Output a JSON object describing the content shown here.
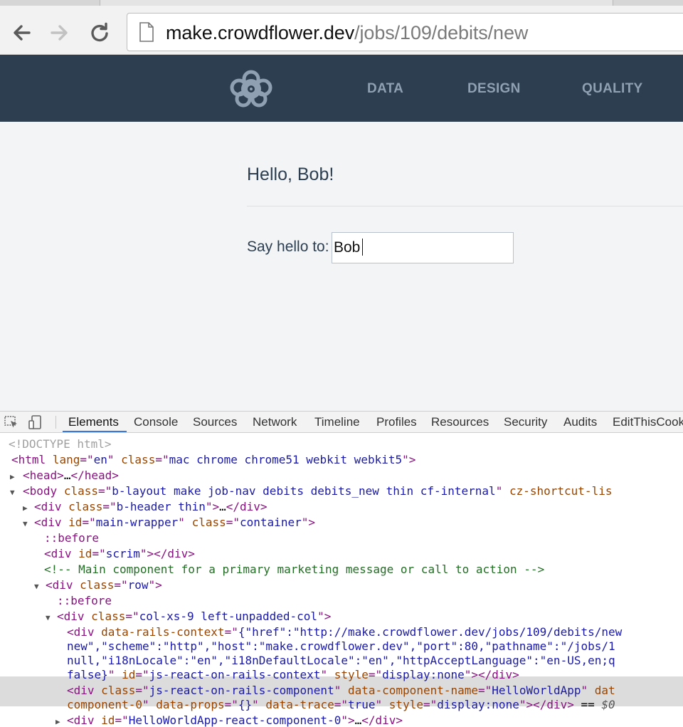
{
  "browser": {
    "url_host": "make.crowdflower.dev",
    "url_path": "/jobs/109/debits/new"
  },
  "site_nav": {
    "items": [
      "DATA",
      "DESIGN",
      "QUALITY"
    ]
  },
  "main": {
    "greeting": "Hello, Bob!",
    "input_label": "Say hello to:",
    "input_value": "Bob"
  },
  "devtools": {
    "tabs": [
      "Elements",
      "Console",
      "Sources",
      "Network",
      "Timeline",
      "Profiles",
      "Resources",
      "Security",
      "Audits",
      "EditThisCook"
    ],
    "active_tab": "Elements",
    "dom": {
      "l1": "<!DOCTYPE html>",
      "l2_tag": "html",
      "l2_lang": "en",
      "l2_class": "mac chrome chrome51 webkit webkit5",
      "l3": "head",
      "l4_class": "b-layout make job-nav debits debits_new thin cf-internal",
      "l4_extra": "cz-shortcut-lis",
      "l5_class": "b-header thin",
      "l6_id": "main-wrapper",
      "l6_class": "container",
      "l7": "::before",
      "l8_id": "scrim",
      "l9": "<!-- Main component for a primary marketing message or call to action -->",
      "l10_class": "row",
      "l11": "::before",
      "l12_class": "col-xs-9 left-unpadded-col",
      "l13_ctx": "{\"href\":\"http://make.crowdflower.dev/jobs/109/debits/new",
      "l14": "new\",\"scheme\":\"http\",\"host\":\"make.crowdflower.dev\",\"port\":80,\"pathname\":\"/jobs/1",
      "l15": "null,\"i18nLocale\":\"en\",\"i18nDefaultLocale\":\"en\",\"httpAcceptLanguage\":\"en-US,en;q",
      "l16_val": "false}",
      "l16_id": "js-react-on-rails-context",
      "l16_style": "display:none",
      "l17_class": "js-react-on-rails-component",
      "l17_comp": "HelloWorldApp",
      "l18_comp": "component-0",
      "l18_props": "{}",
      "l18_trace": "true",
      "l18_style": "display:none",
      "l18_sel": "$0",
      "l19_id": "HelloWorldApp-react-component-0"
    }
  }
}
